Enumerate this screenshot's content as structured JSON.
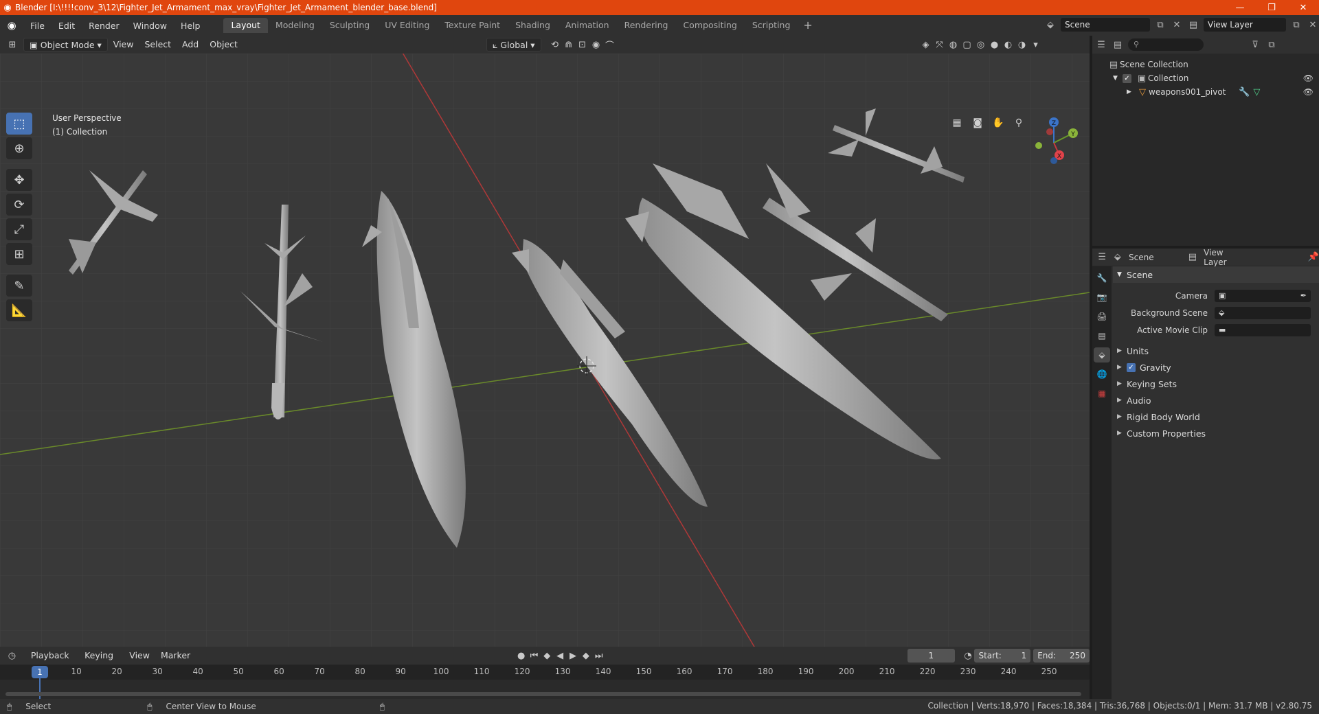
{
  "titlebar": {
    "title": "Blender [I:\\!!!!conv_3\\12\\Fighter_Jet_Armament_max_vray\\Fighter_Jet_Armament_blender_base.blend]",
    "minimize": "—",
    "maximize": "❐",
    "close": "✕"
  },
  "menu": {
    "file": "File",
    "edit": "Edit",
    "render": "Render",
    "window": "Window",
    "help": "Help"
  },
  "workspaces": [
    "Layout",
    "Modeling",
    "Sculpting",
    "UV Editing",
    "Texture Paint",
    "Shading",
    "Animation",
    "Rendering",
    "Compositing",
    "Scripting"
  ],
  "active_workspace": "Layout",
  "top_right": {
    "scene": "Scene",
    "view_layer": "View Layer"
  },
  "viewport_header": {
    "mode": "Object Mode",
    "view": "View",
    "select": "Select",
    "add": "Add",
    "object": "Object",
    "orientation": "Global"
  },
  "viewport": {
    "perspective": "User Perspective",
    "collection": "(1) Collection",
    "axis_x": "X",
    "axis_y": "Y",
    "axis_z": "Z"
  },
  "timeline": {
    "playback": "Playback",
    "keying": "Keying",
    "view": "View",
    "marker": "Marker",
    "current_frame": "1",
    "start_label": "Start:",
    "start_value": "1",
    "end_label": "End:",
    "end_value": "250",
    "frame_labels": [
      "1",
      "10",
      "20",
      "30",
      "40",
      "50",
      "60",
      "70",
      "80",
      "90",
      "100",
      "110",
      "120",
      "130",
      "140",
      "150",
      "160",
      "170",
      "180",
      "190",
      "200",
      "210",
      "220",
      "230",
      "240",
      "250"
    ]
  },
  "statusbar": {
    "select": "Select",
    "center_view": "Center View to Mouse",
    "stats": "Collection | Verts:18,970 | Faces:18,384 | Tris:36,768 | Objects:0/1 | Mem: 31.7 MB | v2.80.75"
  },
  "outliner": {
    "scene_collection": "Scene Collection",
    "collection": "Collection",
    "object": "weapons001_pivot"
  },
  "properties": {
    "header_scene": "Scene",
    "header_view_layer": "View Layer",
    "panel_scene": "Scene",
    "camera_label": "Camera",
    "background_label": "Background Scene",
    "movie_clip_label": "Active Movie Clip",
    "subpanels": [
      "Units",
      "Gravity",
      "Keying Sets",
      "Audio",
      "Rigid Body World",
      "Custom Properties"
    ]
  },
  "colors": {
    "titlebar": "#e0460e",
    "accent": "#4772b3",
    "viewport_bg": "#393939",
    "axis_x": "#b03838",
    "axis_y": "#6a8a2a"
  }
}
